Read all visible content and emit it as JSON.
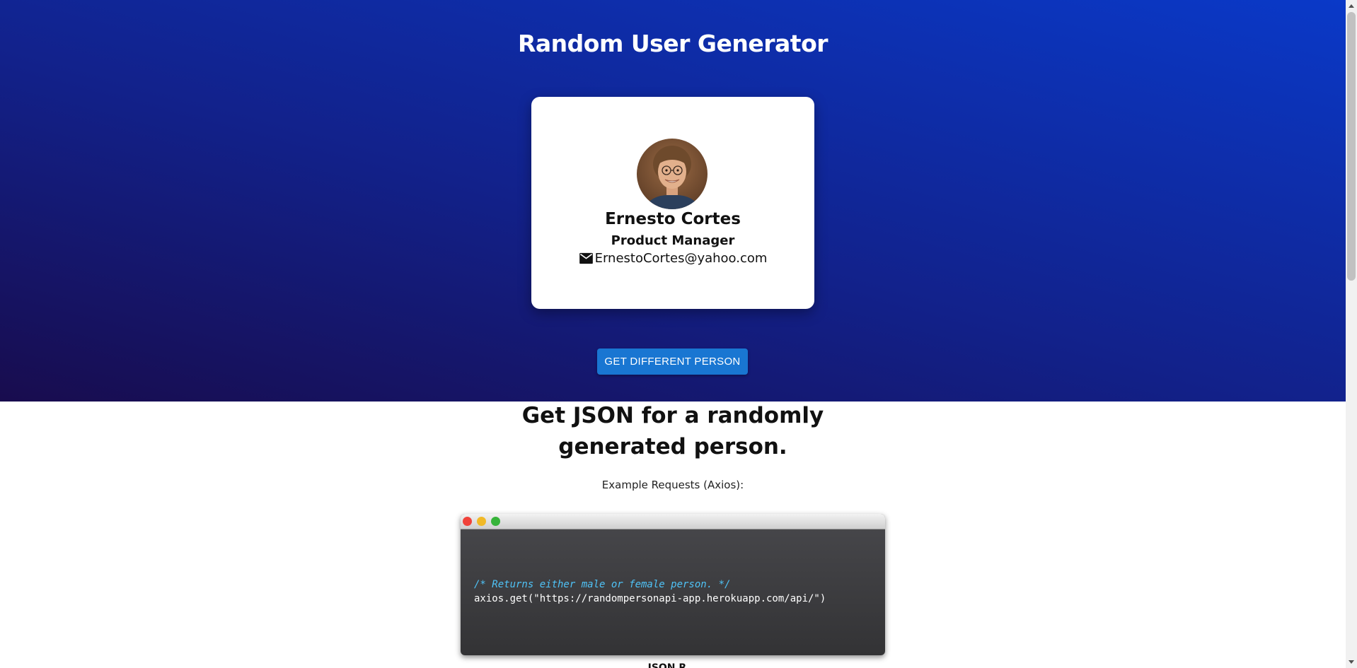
{
  "hero": {
    "title": "Random User Generator",
    "background_colors": [
      "#180c4e",
      "#12218a",
      "#0a39c8"
    ]
  },
  "profile_card": {
    "avatar": "avatar-photo",
    "name": "Ernesto Cortes",
    "job_title": "Product Manager",
    "email_icon": "mail-icon",
    "email": "ErnestoCortes@yahoo.com"
  },
  "actions": {
    "get_different_person_label": "GET DIFFERENT PERSON",
    "button_color": "#1976d2"
  },
  "docs": {
    "heading": "Get JSON for a randomly generated person.",
    "example_label": "Example Requests (Axios):",
    "code_comment": "/* Returns either male or female person. */",
    "code_line": "axios.get(\"https://randompersonapi-app.herokuapp.com/api/\")",
    "code_comment_color": "#4fc3f7",
    "next_heading": "JSON R..."
  },
  "scrollbar": {
    "up_icon": "chevron-up-icon",
    "down_icon": "chevron-down-icon"
  }
}
